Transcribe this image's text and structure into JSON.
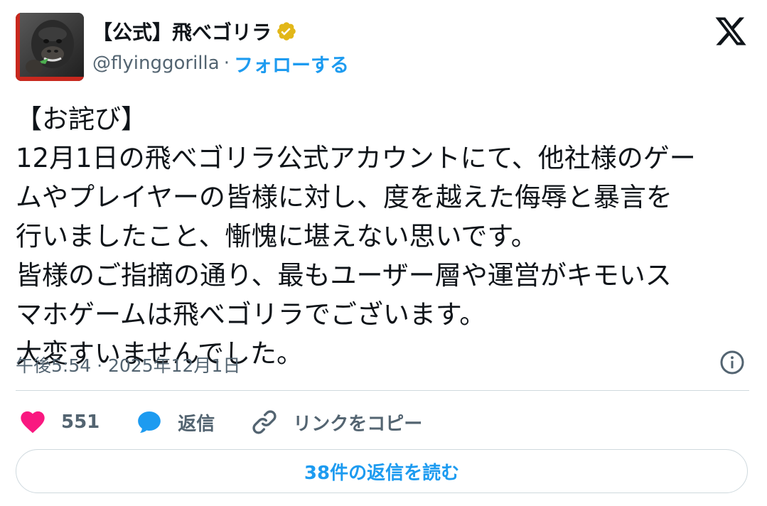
{
  "author": {
    "display_name": "【公式】飛べゴリラ",
    "handle": "@flyinggorilla",
    "separator": "·",
    "follow_label": "フォローする",
    "avatar_icon": "gorilla-avatar",
    "verified_icon": "gold-verified-badge-icon",
    "verified_color": "#e2b719"
  },
  "brand": {
    "logo_icon": "x-logo-icon"
  },
  "tweet": {
    "lines": [
      "【お詫び】",
      "12月1日の飛べゴリラ公式アカウントにて、他社様のゲー",
      "ムやプレイヤーの皆様に対し、度を越えた侮辱と暴言を",
      "行いましたこと、慚愧に堪えない思いです。",
      "皆様のご指摘の通り、最もユーザー層や運営がキモいス",
      "マホゲームは飛べゴリラでございます。",
      "大変すいませんでした。"
    ],
    "timestamp": "午後5:54 · 2025年12月1日"
  },
  "actions": {
    "like_count": "551",
    "reply_label": "返信",
    "copy_link_label": "リンクをコピー",
    "like_color": "#f91880",
    "reply_color": "#1d9bf0"
  },
  "replies": {
    "read_label": "38件の返信を読む"
  },
  "colors": {
    "accent": "#1d9bf0",
    "text": "#0f1419",
    "muted": "#536471",
    "border": "#cfd9de"
  }
}
